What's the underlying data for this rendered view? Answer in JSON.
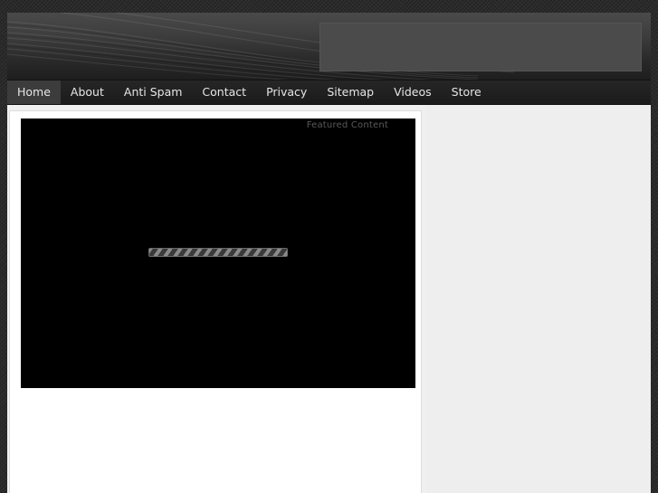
{
  "nav": {
    "items": [
      {
        "label": "Home",
        "active": true
      },
      {
        "label": "About"
      },
      {
        "label": "Anti Spam"
      },
      {
        "label": "Contact"
      },
      {
        "label": "Privacy"
      },
      {
        "label": "Sitemap"
      },
      {
        "label": "Videos"
      },
      {
        "label": "Store"
      }
    ]
  },
  "featured": {
    "label": "Featured Content",
    "loader_icon": "loading-bar-icon"
  },
  "colors": {
    "page_background": "#2b2b2b",
    "nav_background": "#1f1f1f",
    "nav_active": "#3c3c3c",
    "featured_background": "#000000",
    "sidebar_background": "#eeeeee"
  }
}
